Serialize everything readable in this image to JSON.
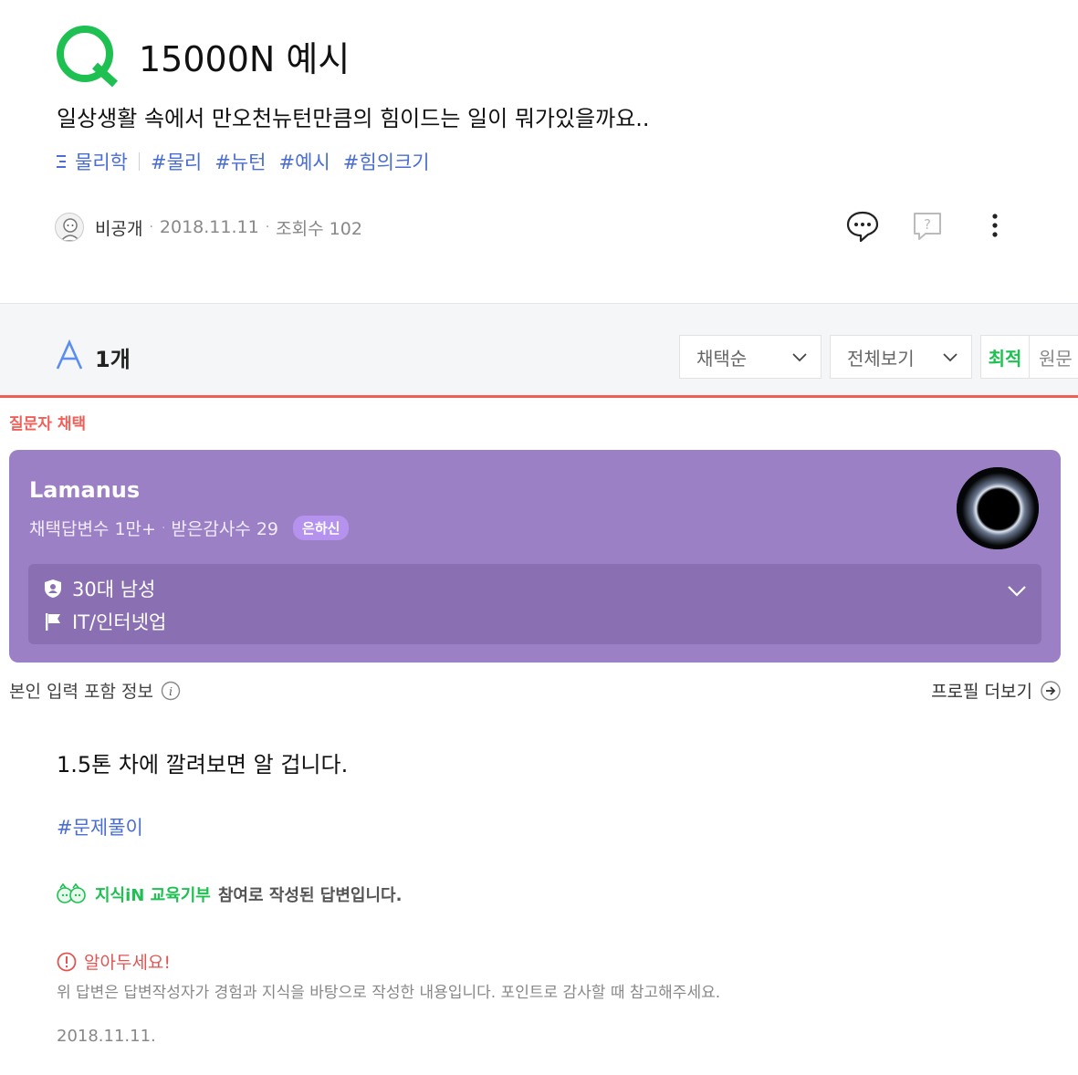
{
  "question": {
    "title": "15000N 예시",
    "body": "일상생활 속에서 만오천뉴턴만큼의 힘이드는 일이 뭐가있을까요..",
    "category": "물리학",
    "tags": [
      "#물리",
      "#뉴턴",
      "#예시",
      "#힘의크기"
    ],
    "author": "비공개",
    "date": "2018.11.11",
    "views_label": "조회수 102"
  },
  "answers_bar": {
    "count_label": "1개",
    "sort_select": "채택순",
    "filter_select": "전체보기",
    "toggle_best": "최적",
    "toggle_original": "원문"
  },
  "chosen_label": "질문자 채택",
  "profile": {
    "name": "Lamanus",
    "stat_chosen": "채택답변수 1만+",
    "stat_thanks": "받은감사수 29",
    "grade_badge": "은하신",
    "age_gender": "30대 남성",
    "field": "IT/인터넷업"
  },
  "self_info_label": "본인 입력 포함 정보",
  "profile_more_label": "프로필 더보기",
  "answer": {
    "text": "1.5톤 차에 깔려보면 알 겁니다.",
    "tag": "#문제풀이",
    "edu_brand": "지식iN 교육기부",
    "edu_suffix": "참여로 작성된 답변입니다.",
    "notice_title": "알아두세요!",
    "notice_body": "위 답변은 답변작성자가 경험과 지식을 바탕으로 작성한 내용입니다. 포인트로 감사할 때 참고해주세요.",
    "date": "2018.11.11."
  },
  "colors": {
    "brand_green": "#1ec052",
    "tag_blue": "#4a6ed2",
    "chosen_red": "#f0605a",
    "profile_purple": "#9c80c5"
  }
}
